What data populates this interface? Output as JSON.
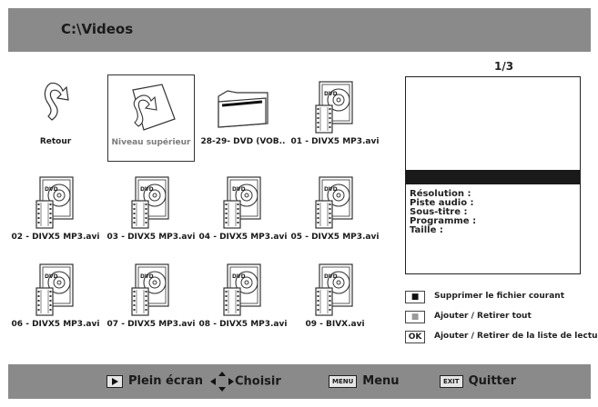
{
  "header": {
    "path": "C:\\Videos"
  },
  "page_indicator": "1/3",
  "items": [
    {
      "label": "Retour",
      "icon": "back-arrow-icon"
    },
    {
      "label": "Niveau supérieur",
      "icon": "parent-folder-icon"
    },
    {
      "label": "28-29- DVD (VOB..",
      "icon": "folder-icon"
    },
    {
      "label": "01 - DIVX5 MP3.avi",
      "icon": "video-file-icon"
    },
    {
      "label": "02 - DIVX5 MP3.avi",
      "icon": "video-file-icon"
    },
    {
      "label": "03 - DIVX5 MP3.avi",
      "icon": "video-file-icon"
    },
    {
      "label": "04 - DIVX5 MP3.avi",
      "icon": "video-file-icon"
    },
    {
      "label": "05 - DIVX5 MP3.avi",
      "icon": "video-file-icon"
    },
    {
      "label": "06 - DIVX5 MP3.avi",
      "icon": "video-file-icon"
    },
    {
      "label": "07 - DIVX5 MP3.avi",
      "icon": "video-file-icon"
    },
    {
      "label": "08 - DIVX5 MP3.avi",
      "icon": "video-file-icon"
    },
    {
      "label": "09 - BIVX.avi",
      "icon": "video-file-icon"
    }
  ],
  "info": {
    "resolution": "Résolution :",
    "audio": "Piste audio :",
    "subtitle": "Sous-titre :",
    "program": "Programme :",
    "size": "Taille :"
  },
  "legend": {
    "delete_key": "■",
    "delete_label": "Supprimer le fichier courant",
    "all_key": "■",
    "all_label": "Ajouter / Retirer tout",
    "ok_key": "OK",
    "ok_label": "Ajouter / Retirer de la liste de lecture"
  },
  "bottom": {
    "fullscreen": "Plein écran",
    "choose": "Choisir",
    "menu_key": "MENU",
    "menu": "Menu",
    "exit_key": "EXIT",
    "quit": "Quitter"
  }
}
